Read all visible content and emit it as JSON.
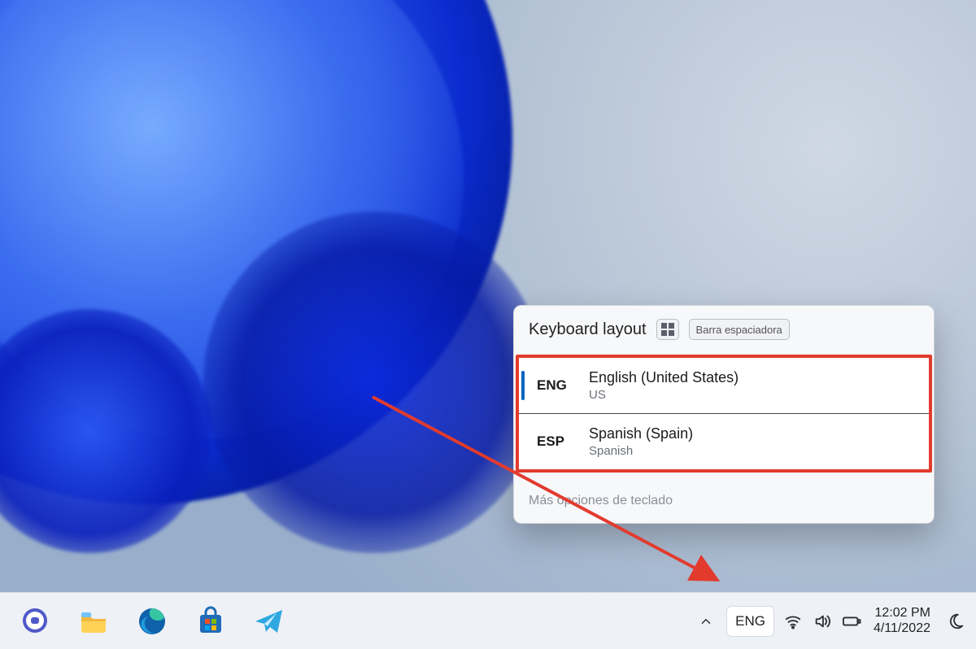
{
  "flyout": {
    "title": "Keyboard layout",
    "shortcut_space_label": "Barra espaciadora",
    "options": [
      {
        "code": "ENG",
        "lang": "English (United States)",
        "sub": "US",
        "selected": true
      },
      {
        "code": "ESP",
        "lang": "Spanish (Spain)",
        "sub": "Spanish",
        "selected": false
      }
    ],
    "more_link": "Más opciones de teclado"
  },
  "taskbar": {
    "lang_code": "ENG",
    "clock_time": "12:02 PM",
    "clock_date": "4/11/2022"
  },
  "annotation": {
    "highlight_color": "#e23b2e"
  }
}
